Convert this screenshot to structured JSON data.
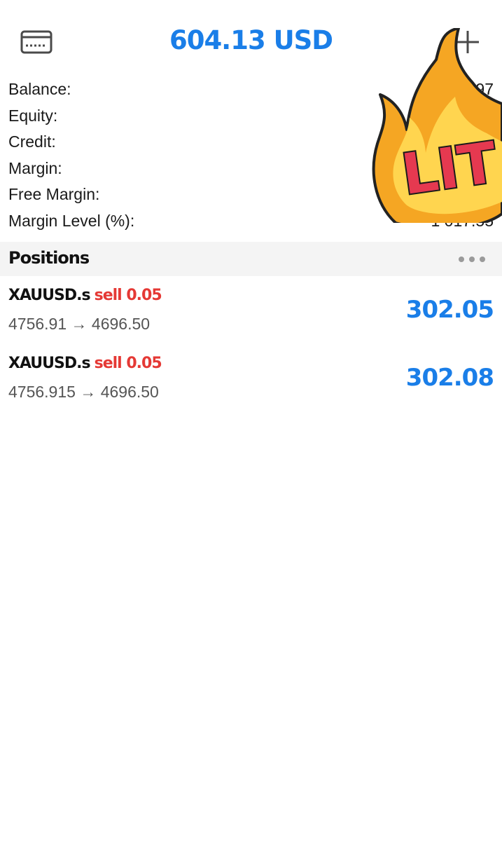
{
  "header": {
    "title": "604.13 USD",
    "card_icon": "card-icon",
    "add_icon": "plus-icon"
  },
  "summary": [
    {
      "label": "Balance:",
      "value": "97"
    },
    {
      "label": "Equity:",
      "value": ""
    },
    {
      "label": "Credit:",
      "value": ""
    },
    {
      "label": "Margin:",
      "value": ""
    },
    {
      "label": "Free Margin:",
      "value": ""
    },
    {
      "label": "Margin Level (%):",
      "value": "1 017.55"
    }
  ],
  "positions_section": {
    "title": "Positions",
    "more_icon": "ellipsis-icon"
  },
  "positions": [
    {
      "symbol": "XAUUSD.s",
      "side": "sell 0.05",
      "prices": "4756.91 → 4696.50",
      "profit": "302.05"
    },
    {
      "symbol": "XAUUSD.s",
      "side": "sell 0.05",
      "prices": "4756.915 → 4696.50",
      "profit": "302.08"
    }
  ],
  "sticker": {
    "text": "LIT"
  },
  "colors": {
    "accent": "#1a7ee8",
    "sell": "#e53935",
    "flame_outer": "#f5a623",
    "flame_inner": "#ffd54f",
    "sticker_text": "#e53950"
  }
}
